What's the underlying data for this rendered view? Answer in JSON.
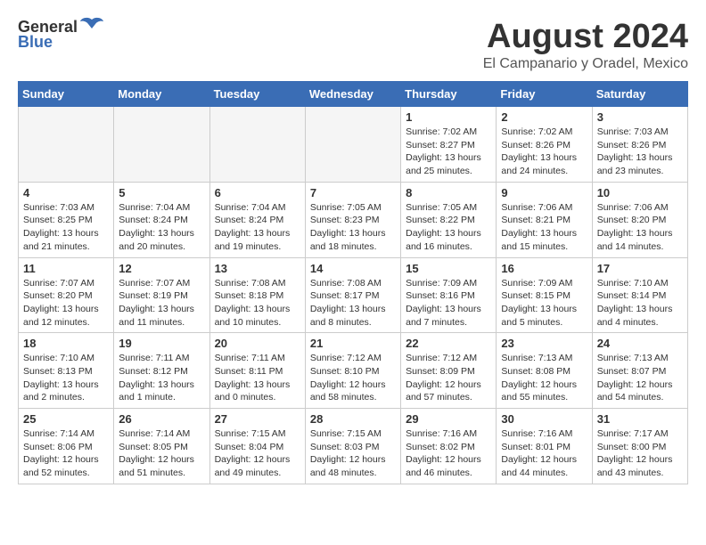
{
  "header": {
    "logo_general": "General",
    "logo_blue": "Blue",
    "month_title": "August 2024",
    "location": "El Campanario y Oradel, Mexico"
  },
  "days_of_week": [
    "Sunday",
    "Monday",
    "Tuesday",
    "Wednesday",
    "Thursday",
    "Friday",
    "Saturday"
  ],
  "weeks": [
    [
      {
        "day": "",
        "info": ""
      },
      {
        "day": "",
        "info": ""
      },
      {
        "day": "",
        "info": ""
      },
      {
        "day": "",
        "info": ""
      },
      {
        "day": "1",
        "info": "Sunrise: 7:02 AM\nSunset: 8:27 PM\nDaylight: 13 hours and 25 minutes."
      },
      {
        "day": "2",
        "info": "Sunrise: 7:02 AM\nSunset: 8:26 PM\nDaylight: 13 hours and 24 minutes."
      },
      {
        "day": "3",
        "info": "Sunrise: 7:03 AM\nSunset: 8:26 PM\nDaylight: 13 hours and 23 minutes."
      }
    ],
    [
      {
        "day": "4",
        "info": "Sunrise: 7:03 AM\nSunset: 8:25 PM\nDaylight: 13 hours and 21 minutes."
      },
      {
        "day": "5",
        "info": "Sunrise: 7:04 AM\nSunset: 8:24 PM\nDaylight: 13 hours and 20 minutes."
      },
      {
        "day": "6",
        "info": "Sunrise: 7:04 AM\nSunset: 8:24 PM\nDaylight: 13 hours and 19 minutes."
      },
      {
        "day": "7",
        "info": "Sunrise: 7:05 AM\nSunset: 8:23 PM\nDaylight: 13 hours and 18 minutes."
      },
      {
        "day": "8",
        "info": "Sunrise: 7:05 AM\nSunset: 8:22 PM\nDaylight: 13 hours and 16 minutes."
      },
      {
        "day": "9",
        "info": "Sunrise: 7:06 AM\nSunset: 8:21 PM\nDaylight: 13 hours and 15 minutes."
      },
      {
        "day": "10",
        "info": "Sunrise: 7:06 AM\nSunset: 8:20 PM\nDaylight: 13 hours and 14 minutes."
      }
    ],
    [
      {
        "day": "11",
        "info": "Sunrise: 7:07 AM\nSunset: 8:20 PM\nDaylight: 13 hours and 12 minutes."
      },
      {
        "day": "12",
        "info": "Sunrise: 7:07 AM\nSunset: 8:19 PM\nDaylight: 13 hours and 11 minutes."
      },
      {
        "day": "13",
        "info": "Sunrise: 7:08 AM\nSunset: 8:18 PM\nDaylight: 13 hours and 10 minutes."
      },
      {
        "day": "14",
        "info": "Sunrise: 7:08 AM\nSunset: 8:17 PM\nDaylight: 13 hours and 8 minutes."
      },
      {
        "day": "15",
        "info": "Sunrise: 7:09 AM\nSunset: 8:16 PM\nDaylight: 13 hours and 7 minutes."
      },
      {
        "day": "16",
        "info": "Sunrise: 7:09 AM\nSunset: 8:15 PM\nDaylight: 13 hours and 5 minutes."
      },
      {
        "day": "17",
        "info": "Sunrise: 7:10 AM\nSunset: 8:14 PM\nDaylight: 13 hours and 4 minutes."
      }
    ],
    [
      {
        "day": "18",
        "info": "Sunrise: 7:10 AM\nSunset: 8:13 PM\nDaylight: 13 hours and 2 minutes."
      },
      {
        "day": "19",
        "info": "Sunrise: 7:11 AM\nSunset: 8:12 PM\nDaylight: 13 hours and 1 minute."
      },
      {
        "day": "20",
        "info": "Sunrise: 7:11 AM\nSunset: 8:11 PM\nDaylight: 13 hours and 0 minutes."
      },
      {
        "day": "21",
        "info": "Sunrise: 7:12 AM\nSunset: 8:10 PM\nDaylight: 12 hours and 58 minutes."
      },
      {
        "day": "22",
        "info": "Sunrise: 7:12 AM\nSunset: 8:09 PM\nDaylight: 12 hours and 57 minutes."
      },
      {
        "day": "23",
        "info": "Sunrise: 7:13 AM\nSunset: 8:08 PM\nDaylight: 12 hours and 55 minutes."
      },
      {
        "day": "24",
        "info": "Sunrise: 7:13 AM\nSunset: 8:07 PM\nDaylight: 12 hours and 54 minutes."
      }
    ],
    [
      {
        "day": "25",
        "info": "Sunrise: 7:14 AM\nSunset: 8:06 PM\nDaylight: 12 hours and 52 minutes."
      },
      {
        "day": "26",
        "info": "Sunrise: 7:14 AM\nSunset: 8:05 PM\nDaylight: 12 hours and 51 minutes."
      },
      {
        "day": "27",
        "info": "Sunrise: 7:15 AM\nSunset: 8:04 PM\nDaylight: 12 hours and 49 minutes."
      },
      {
        "day": "28",
        "info": "Sunrise: 7:15 AM\nSunset: 8:03 PM\nDaylight: 12 hours and 48 minutes."
      },
      {
        "day": "29",
        "info": "Sunrise: 7:16 AM\nSunset: 8:02 PM\nDaylight: 12 hours and 46 minutes."
      },
      {
        "day": "30",
        "info": "Sunrise: 7:16 AM\nSunset: 8:01 PM\nDaylight: 12 hours and 44 minutes."
      },
      {
        "day": "31",
        "info": "Sunrise: 7:17 AM\nSunset: 8:00 PM\nDaylight: 12 hours and 43 minutes."
      }
    ]
  ]
}
